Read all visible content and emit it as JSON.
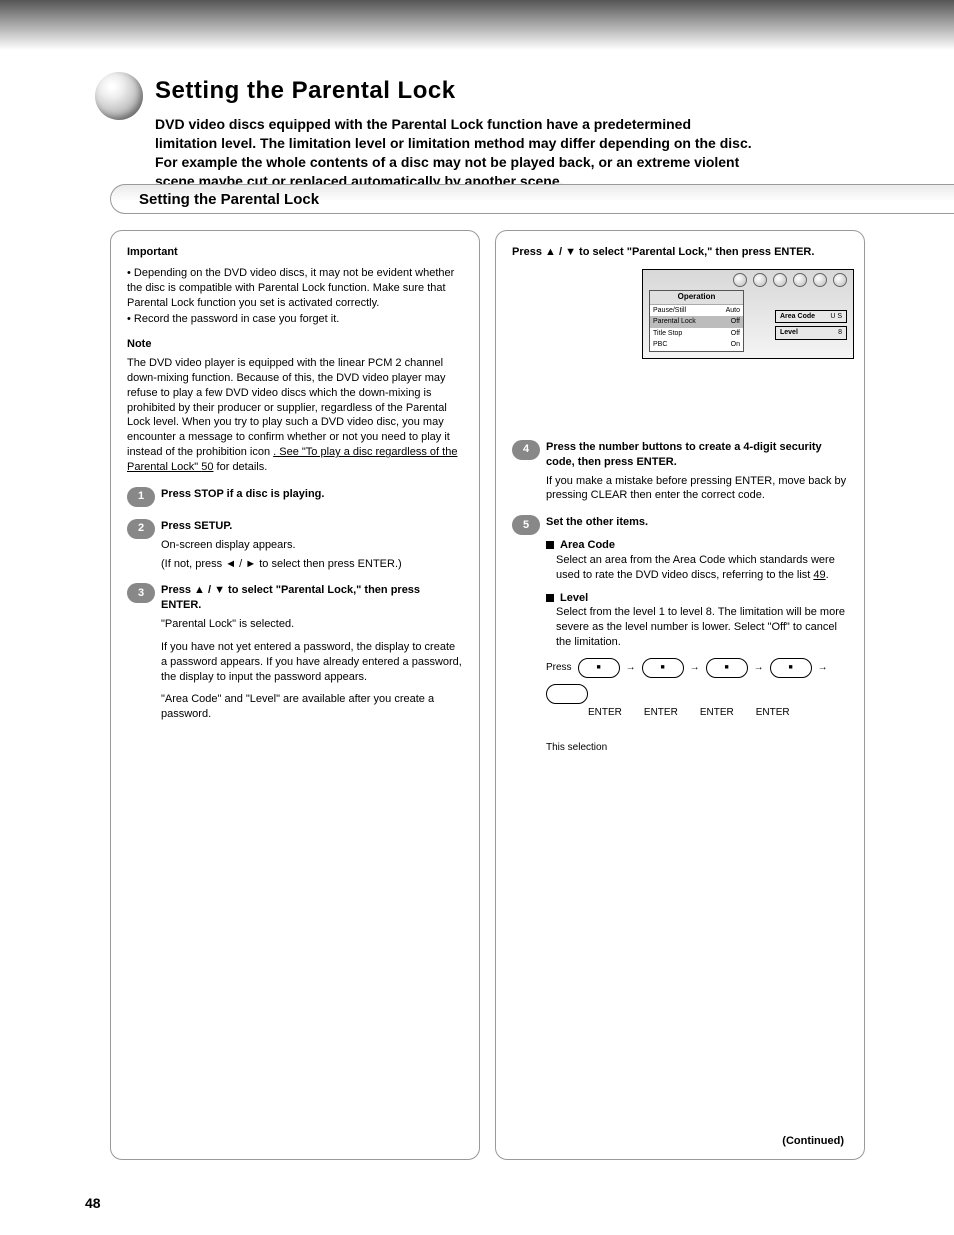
{
  "page_number": "48",
  "title": "Setting the Parental Lock",
  "intro_l1": "DVD video discs equipped with the Parental Lock function have a predetermined",
  "intro_l2": "limitation level. The limitation level or limitation method may differ depending on the disc.",
  "intro_l3": "For example the whole contents of a disc may not be played back, or an extreme violent",
  "intro_l4": "scene maybe cut or replaced automatically by another scene.",
  "section_title": "Setting the Parental Lock",
  "important_label": "Important",
  "imp_b1": "• Depending on the DVD video discs, it may not be evident whether the disc is compatible with Parental Lock function. Make sure that Parental Lock function you set is activated correctly.",
  "imp_b2": "• Record the password in case you forget it.",
  "note_label": "Note",
  "note_text": "The DVD video player is equipped with the linear PCM 2 channel down-mixing function. Because of this, the DVD video player may refuse to play a few DVD video discs which the down-mixing is prohibited by their producer or supplier, regardless of the Parental Lock level. When you try to play such a DVD video disc, you may encounter a message to confirm whether or not you need to play it instead of the prohibition icon ",
  "note_see": ". See \"To play a disc regardless of the Parental Lock\" ",
  "note_page": "50",
  "note_tail": " for details.",
  "step1_head": "Press STOP if a disc is playing.",
  "step2_head": "Press SETUP.",
  "step3_head": "Press ",
  "step3_head2": " to select \"Parental Lock,\" then press ENTER.",
  "step3_body1": "\"Parental Lock\" is selected.",
  "step3_body2a": "If you have not yet entered a password, the display to create a password appears. If you have already entered a password, the display to input the password appears.",
  "step3_body2b": "\"Area Code\" and \"Level\" are available after you create a password.",
  "step2_body": "On-screen display appears.",
  "step2_body2": "(If not, press ",
  "step2_body3": " to select ",
  "step2_body4": " then press ENTER.)",
  "step4_head": "Press the number buttons to create a 4-digit security code, then press ENTER.",
  "step4_body": "If you make a mistake before pressing ENTER, move back by pressing CLEAR then enter the correct code.",
  "step5_head": "Set the other items.",
  "area_code_label": "Area Code",
  "area_code_body": "Select an area from the Area Code which standards were used to rate the DVD video discs, referring to the list ",
  "area_code_page": "49",
  "level_label": "Level",
  "level_body": "Select from the level 1 to level 8. The limitation will be more severe as the level number is lower. Select \"Off\" to cancel the limitation.",
  "seq_press": "Press",
  "seq_enter": "ENTER",
  "seq_last": "This selection",
  "ss_op": "Operation",
  "ss_r1a": "Pause/Still",
  "ss_r1b": "Auto",
  "ss_r2a": "Parental Lock",
  "ss_r2b": "Off",
  "ss_r3a": "Title Stop",
  "ss_r3b": "Off",
  "ss_r4a": "PBC",
  "ss_r4b": "On",
  "ss_ac": "Area Code",
  "ss_ac_v": "U  S",
  "ss_lv": "Level",
  "ss_lv_v": "8",
  "continued": "(Continued)"
}
